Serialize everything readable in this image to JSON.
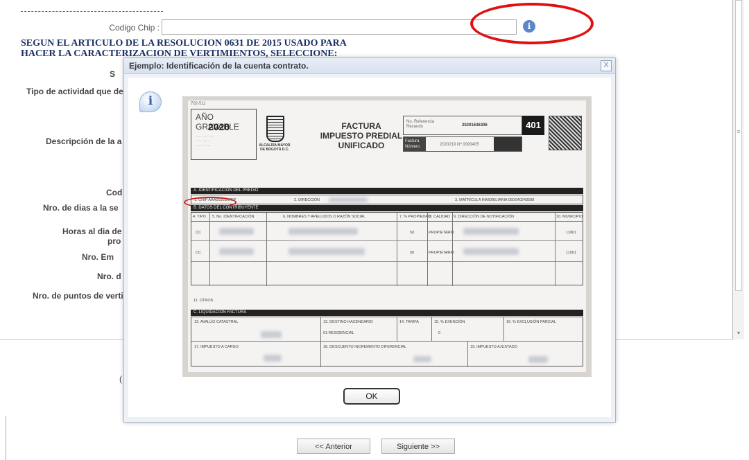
{
  "form": {
    "chip_label": "Codigo Chip :",
    "chip_value": "",
    "info_icon": "info-icon",
    "article_text": "SEGUN EL ARTICULO DE LA RESOLUCION 0631 DE 2015 USADO PARA HACER LA CARACTERIZACION DE VERTIMIENTOS, SELECCIONE:",
    "partial_labels": [
      "S",
      "Tipo de actividad que de",
      "Descripción de la a",
      "Cod",
      "Nro. de dias a la se",
      "Horas al dia de",
      "pro",
      "Nro. Em",
      "Nro. d",
      "Nro. de puntos de verti",
      "("
    ]
  },
  "nav": {
    "prev_label": "<< Anterior",
    "next_label": "Siguiente >>"
  },
  "dialog": {
    "title": "Ejemplo: Identificación de la cuenta contrato.",
    "close_label": "X",
    "info_glyph": "i",
    "ok_label": "OK"
  },
  "invoice": {
    "top_code": "702-511",
    "anio_label": "AÑO GRAVABLE",
    "year": "2020",
    "alcaldia": "ALCALDÍA MAYOR DE BOGOTÁ D.C.",
    "title_lines": [
      "FACTURA",
      "IMPUESTO PREDIAL",
      "UNIFICADO"
    ],
    "ref_label": "No. Referencia Recaudo",
    "ref_value": "20201636306",
    "form_code": "401",
    "factura_label": "Factura Número",
    "factura_value": "2020219 Nº 0093405",
    "sec_a": "A. IDENTIFICACIÓN DEL PREDIO",
    "chip_cell": "1. CHIP AAA0016UWEP",
    "dir_cell": "2. DIRECCIÓN",
    "matricula_cell": "3. MATRÍCULA INMOBILIARIA 050S40243598",
    "sec_b": "B. DATOS DEL CONTRIBUYENTE",
    "b_headers": [
      "4. TIPO",
      "5. No. IDENTIFICACIÓN",
      "6. NOMBRES Y APELLIDOS O RAZÓN SOCIAL",
      "7. % PROPIEDAD",
      "8. CALIDAD",
      "9. DIRECCIÓN DE NOTIFICACIÓN",
      "10. MUNICIPIO"
    ],
    "b_rows": [
      [
        "CC",
        "50",
        "PROPIETARIO",
        "11001"
      ],
      [
        "CC",
        "50",
        "PROPIETARIO",
        "11001"
      ]
    ],
    "otros": "11. OTROS",
    "sec_c": "C. LIQUIDACIÓN FACTURA",
    "c_row1": [
      "12. AVALÚO CATASTRAL",
      "13. DESTINO HACENDARIO",
      "61-RESIDENCIAL",
      "14. TARIFA",
      "15. % EXENCIÓN",
      "0",
      "16. % EXCLUSIÓN PARCIAL"
    ],
    "c_row2": [
      "17. IMPUESTO A CARGO",
      "18. DESCUENTO INCREMENTO DIFERENCIAL",
      "19. IMPUESTO AJUSTADO"
    ]
  },
  "colors": {
    "title_blue": "#1a2f66",
    "highlight_red": "#e01010"
  }
}
